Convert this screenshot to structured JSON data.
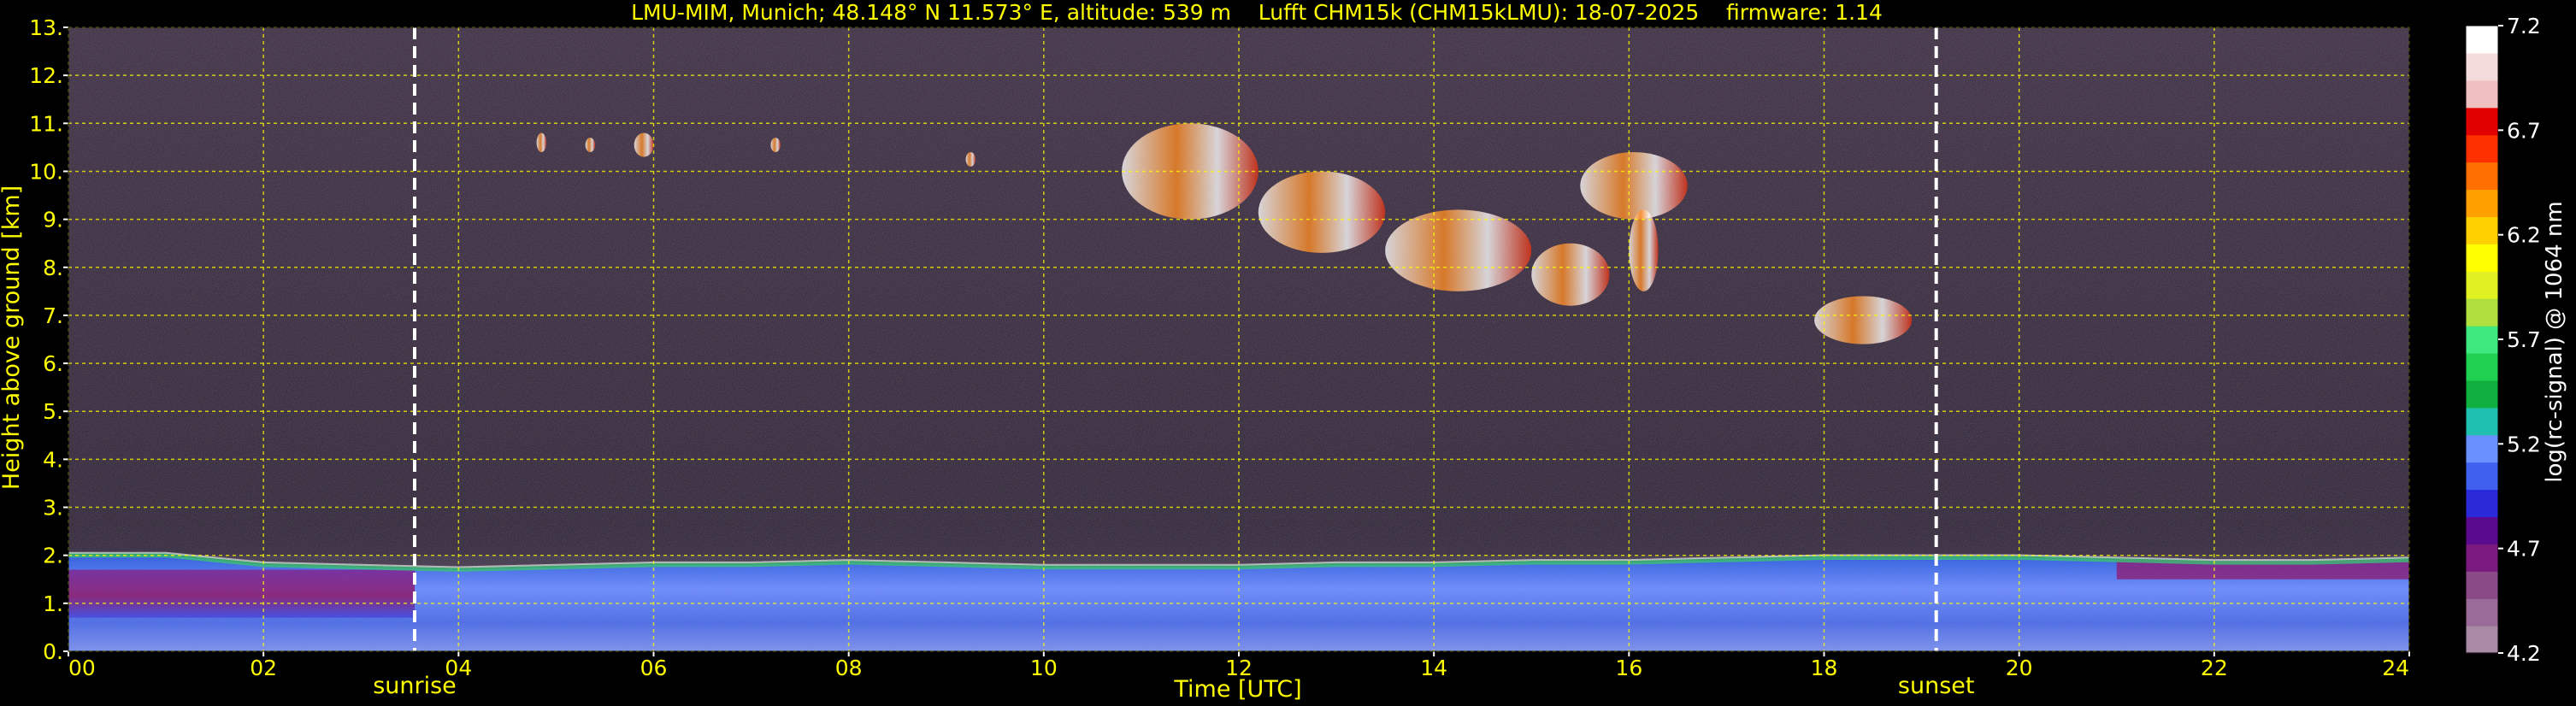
{
  "chart_data": {
    "type": "heatmap",
    "title": "LMU-MIM, Munich; 48.148° N 11.573° E, altitude: 539 m    Lufft CHM15k (CHM15kLMU): 18-07-2025    firmware: 1.14",
    "xlabel": "Time [UTC]",
    "ylabel": "Height above ground [km]",
    "xlim": [
      0,
      24
    ],
    "ylim": [
      0,
      13
    ],
    "x_ticks": [
      "00",
      "02",
      "04",
      "06",
      "08",
      "10",
      "12",
      "14",
      "16",
      "18",
      "20",
      "22",
      "24"
    ],
    "y_ticks": [
      "0.",
      "1.",
      "2.",
      "3.",
      "4.",
      "5.",
      "6.",
      "7.",
      "8.",
      "9.",
      "10.",
      "11.",
      "12.",
      "13."
    ],
    "grid": true,
    "grid_color": "#ffff00",
    "text_color": "#ffff00",
    "markers": [
      {
        "label": "sunrise",
        "time": 3.55
      },
      {
        "label": "sunset",
        "time": 19.15
      }
    ],
    "colorbar": {
      "label": "log(rc-signal) @ 1064 nm",
      "range": [
        4.2,
        7.2
      ],
      "ticks": [
        "4.2",
        "4.7",
        "5.2",
        "5.7",
        "6.2",
        "6.7",
        "7.2"
      ],
      "colors": [
        "#a88aa6",
        "#9a6a99",
        "#8a4a88",
        "#7a1a7e",
        "#5a0a8e",
        "#2a2ad8",
        "#4060f0",
        "#6a90ff",
        "#20c0b0",
        "#10b040",
        "#20d050",
        "#40e880",
        "#b0e040",
        "#e0f020",
        "#ffff00",
        "#ffd000",
        "#ffa000",
        "#ff7000",
        "#ff3000",
        "#e00000",
        "#f0c0c0",
        "#f4dcdc",
        "#ffffff"
      ]
    },
    "series": [
      {
        "name": "boundary layer top [km]",
        "x": [
          0,
          1,
          2,
          3,
          4,
          5,
          6,
          7,
          8,
          9,
          10,
          11,
          12,
          13,
          14,
          15,
          16,
          17,
          18,
          19,
          20,
          21,
          22,
          23,
          24
        ],
        "y": [
          2.0,
          2.0,
          1.8,
          1.75,
          1.7,
          1.75,
          1.8,
          1.8,
          1.85,
          1.8,
          1.75,
          1.75,
          1.75,
          1.8,
          1.8,
          1.85,
          1.85,
          1.9,
          1.95,
          1.95,
          1.95,
          1.9,
          1.85,
          1.85,
          1.9
        ]
      },
      {
        "name": "cirrus patches",
        "patches": [
          {
            "t0": 4.8,
            "t1": 4.9,
            "h0": 10.4,
            "h1": 10.8
          },
          {
            "t0": 5.3,
            "t1": 5.4,
            "h0": 10.4,
            "h1": 10.7
          },
          {
            "t0": 5.8,
            "t1": 6.0,
            "h0": 10.3,
            "h1": 10.8
          },
          {
            "t0": 7.2,
            "t1": 7.3,
            "h0": 10.4,
            "h1": 10.7
          },
          {
            "t0": 9.2,
            "t1": 9.3,
            "h0": 10.1,
            "h1": 10.4
          },
          {
            "t0": 10.8,
            "t1": 12.2,
            "h0": 9.0,
            "h1": 11.0
          },
          {
            "t0": 12.2,
            "t1": 13.5,
            "h0": 8.3,
            "h1": 10.0
          },
          {
            "t0": 13.5,
            "t1": 15.0,
            "h0": 7.5,
            "h1": 9.2
          },
          {
            "t0": 15.0,
            "t1": 15.8,
            "h0": 7.2,
            "h1": 8.5
          },
          {
            "t0": 15.5,
            "t1": 16.6,
            "h0": 9.0,
            "h1": 10.4
          },
          {
            "t0": 16.0,
            "t1": 16.3,
            "h0": 7.5,
            "h1": 9.2
          },
          {
            "t0": 17.9,
            "t1": 18.9,
            "h0": 6.4,
            "h1": 7.4
          }
        ]
      }
    ]
  }
}
